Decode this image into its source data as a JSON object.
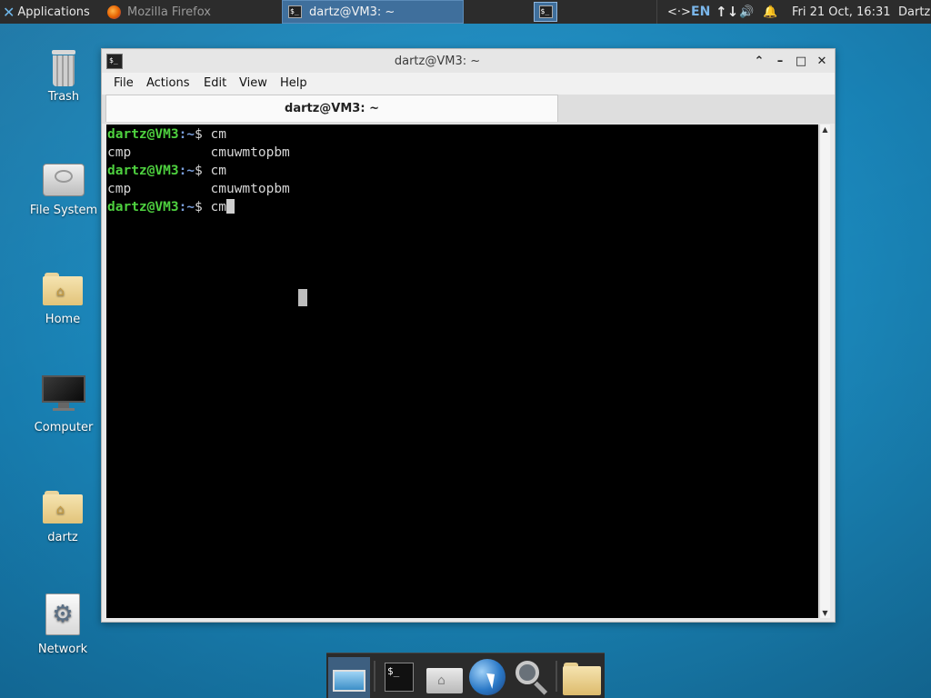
{
  "top_panel": {
    "applications_label": "Applications",
    "tasks": [
      {
        "label": "Mozilla Firefox",
        "icon": "firefox-icon",
        "active": false
      },
      {
        "label": "dartz@VM3: ~",
        "icon": "terminal-icon",
        "active": true
      }
    ],
    "tray": {
      "network_icon": "<·>",
      "language": "EN",
      "transfer_icon": "↑↓",
      "volume_icon": "🔊",
      "notification_icon": "🔔"
    },
    "clock": "Fri 21 Oct, 16:31",
    "user": "Dartz"
  },
  "desktop_icons": [
    {
      "name": "trash",
      "label": "Trash"
    },
    {
      "name": "file-system",
      "label": "File System"
    },
    {
      "name": "home",
      "label": "Home"
    },
    {
      "name": "computer",
      "label": "Computer"
    },
    {
      "name": "dartz",
      "label": "dartz"
    },
    {
      "name": "network",
      "label": "Network"
    }
  ],
  "window": {
    "title": "dartz@VM3: ~",
    "menu": [
      "File",
      "Actions",
      "Edit",
      "View",
      "Help"
    ],
    "tab_label": "dartz@VM3: ~",
    "terminal": {
      "prompt_user": "dartz@VM3",
      "prompt_path": ":~",
      "prompt_symbol": "$ ",
      "lines": [
        {
          "type": "prompt",
          "command": "cm"
        },
        {
          "type": "output",
          "text": "cmp          cmuwmtopbm"
        },
        {
          "type": "prompt",
          "command": "cm"
        },
        {
          "type": "output",
          "text": "cmp          cmuwmtopbm"
        },
        {
          "type": "prompt",
          "command": "cm",
          "cursor": true
        }
      ]
    }
  },
  "colors": {
    "desktop": "#1b8bc0",
    "panel": "#2c2c2c",
    "prompt_user": "#4ed13f",
    "prompt_path": "#7a9fdc"
  },
  "dock": [
    "show-desktop",
    "terminal",
    "home-folder",
    "web-browser",
    "app-finder",
    "file-manager"
  ]
}
